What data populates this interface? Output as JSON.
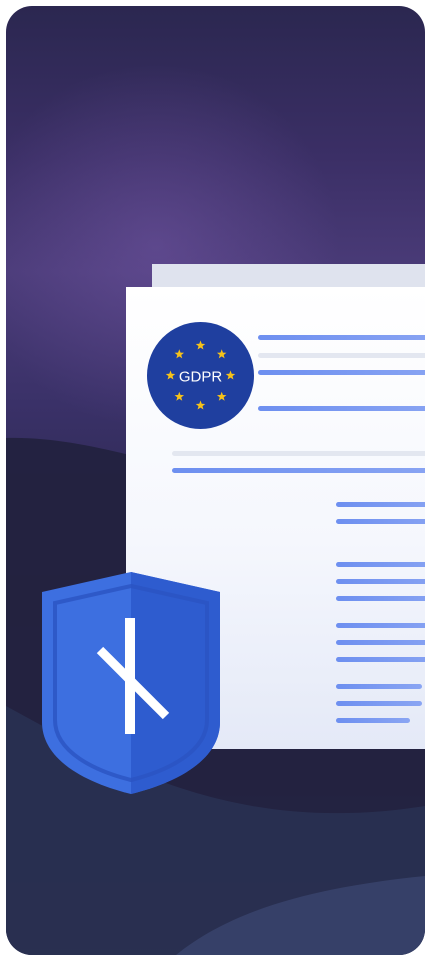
{
  "seal": {
    "text": "GDPR",
    "color": "#1f3f9f",
    "star_color": "#f6c21a"
  },
  "shield": {
    "color": "#3d6fe0"
  },
  "icons": {
    "seal": "eu-gdpr-seal-icon",
    "shield": "security-shield-icon"
  }
}
